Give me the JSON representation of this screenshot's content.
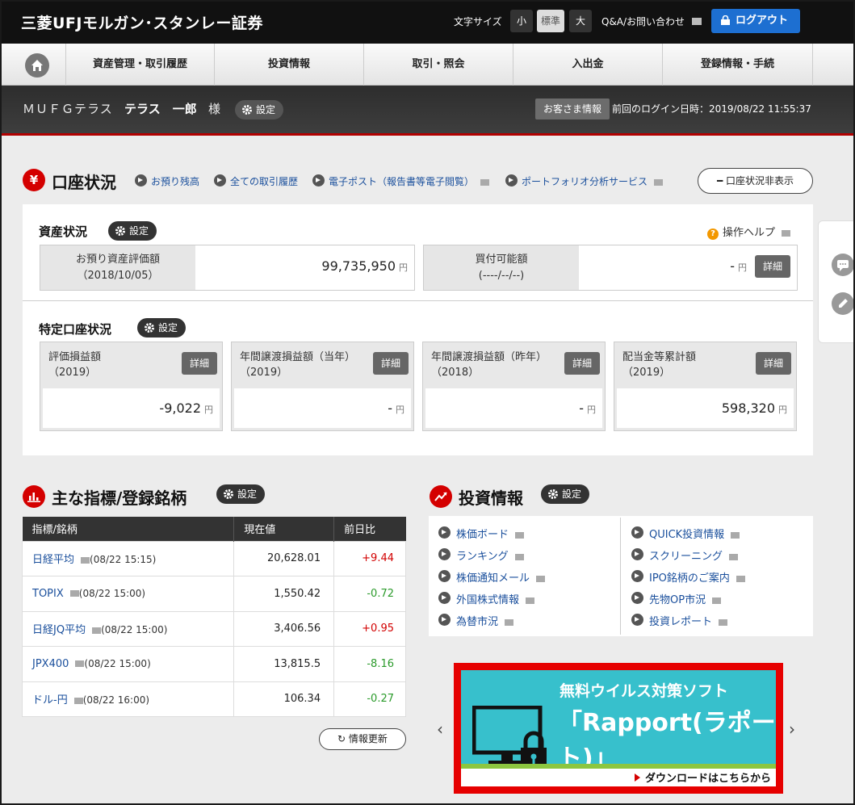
{
  "header": {
    "logo": "三菱UFJモルガン･スタンレー証券",
    "font_size_label": "文字サイズ",
    "font_sizes": [
      "小",
      "標準",
      "大"
    ],
    "qa_link": "Q&A/お問い合わせ",
    "logout": "ログアウト"
  },
  "nav": {
    "items": [
      "資産管理・取引履歴",
      "投資情報",
      "取引・照会",
      "入出金",
      "登録情報・手続"
    ]
  },
  "user": {
    "prefix": "ＭＵＦＧテラス",
    "name": "テラス　一郎",
    "suffix": "様",
    "settings": "設定",
    "customer_info": "お客さま情報",
    "last_login": "前回のログイン日時：2019/08/22 11:55:37"
  },
  "account": {
    "icon": "¥",
    "title": "口座状況",
    "links": [
      "お預り残高",
      "全ての取引履歴",
      "電子ポスト（報告書等電子閲覧）",
      "ポートフォリオ分析サービス"
    ],
    "hide_button": "口座状況非表示",
    "asset_title": "資産状況",
    "settings": "設定",
    "help": "操作ヘルプ",
    "valuation_label": "お預り資産評価額",
    "valuation_date": "（2018/10/05）",
    "valuation_value": "99,735,950",
    "buying_power_label": "買付可能額",
    "buying_power_date": "(----/--/--)",
    "buying_power_value": "-",
    "yen": "円",
    "detail": "詳細",
    "tokutei_title": "特定口座状況",
    "tokutei": [
      {
        "label": "評価損益額",
        "sub": "（2019）",
        "value": "-9,022"
      },
      {
        "label": "年間譲渡損益額（当年）",
        "sub": "（2019）",
        "value": "-"
      },
      {
        "label": "年間譲渡損益額（昨年）",
        "sub": "（2018）",
        "value": "-"
      },
      {
        "label": "配当金等累計額",
        "sub": "（2019）",
        "value": "598,320"
      }
    ]
  },
  "indices": {
    "title": "主な指標/登録銘柄",
    "settings": "設定",
    "columns": [
      "指標/銘柄",
      "現在値",
      "前日比"
    ],
    "rows": [
      {
        "name": "日経平均",
        "time": "(08/22 15:15)",
        "price": "20,628.01",
        "change": "+9.44"
      },
      {
        "name": "TOPIX",
        "time": "(08/22 15:00)",
        "price": "1,550.42",
        "change": "-0.72"
      },
      {
        "name": "日経JQ平均",
        "time": "(08/22 15:00)",
        "price": "3,406.56",
        "change": "+0.95"
      },
      {
        "name": "JPX400",
        "time": "(08/22 15:00)",
        "price": "13,815.5",
        "change": "-8.16"
      },
      {
        "name": "ドル-円",
        "time": "(08/22 16:00)",
        "price": "106.34",
        "change": "-0.27"
      }
    ],
    "refresh": "情報更新"
  },
  "invest": {
    "title": "投資情報",
    "settings": "設定",
    "left": [
      "株価ボード",
      "ランキング",
      "株価通知メール",
      "外国株式情報",
      "為替市況"
    ],
    "right": [
      "QUICK投資情報",
      "スクリーニング",
      "IPO銘柄のご案内",
      "先物OP市況",
      "投資レポート"
    ]
  },
  "banner": {
    "line1": "無料ウイルス対策ソフト",
    "line2": "「Rapport(ラポート)」",
    "cta": "ダウンロードはこちらから"
  },
  "colors": {
    "accent_red": "#d40000",
    "link_blue": "#1a4f9c",
    "logout_blue": "#1d6fd1",
    "up": "#d20000",
    "down": "#2a9a2a"
  }
}
